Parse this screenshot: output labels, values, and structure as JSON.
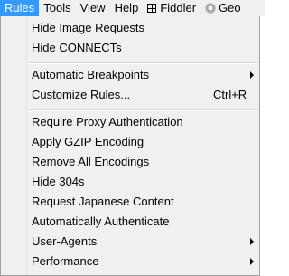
{
  "menubar": {
    "items": [
      {
        "label": "Rules",
        "active": true
      },
      {
        "label": "Tools"
      },
      {
        "label": "View"
      },
      {
        "label": "Help"
      },
      {
        "label": "Fiddler",
        "icon": "fiddler-icon"
      },
      {
        "label": "Geo",
        "icon": "geo-icon"
      }
    ]
  },
  "rules_menu": {
    "group1": [
      {
        "label": "Hide Image Requests"
      },
      {
        "label": "Hide CONNECTs"
      }
    ],
    "group2": [
      {
        "label": "Automatic Breakpoints",
        "submenu": true
      },
      {
        "label": "Customize Rules...",
        "shortcut": "Ctrl+R"
      }
    ],
    "group3": [
      {
        "label": "Require Proxy Authentication"
      },
      {
        "label": "Apply GZIP Encoding"
      },
      {
        "label": "Remove All Encodings"
      },
      {
        "label": "Hide 304s"
      },
      {
        "label": "Request Japanese Content"
      },
      {
        "label": "Automatically Authenticate"
      },
      {
        "label": "User-Agents",
        "submenu": true
      },
      {
        "label": "Performance",
        "submenu": true
      }
    ]
  },
  "colors": {
    "menu_bg": "#f0f0f0",
    "highlight": "#3399ff",
    "separator": "#d5d5d5"
  }
}
